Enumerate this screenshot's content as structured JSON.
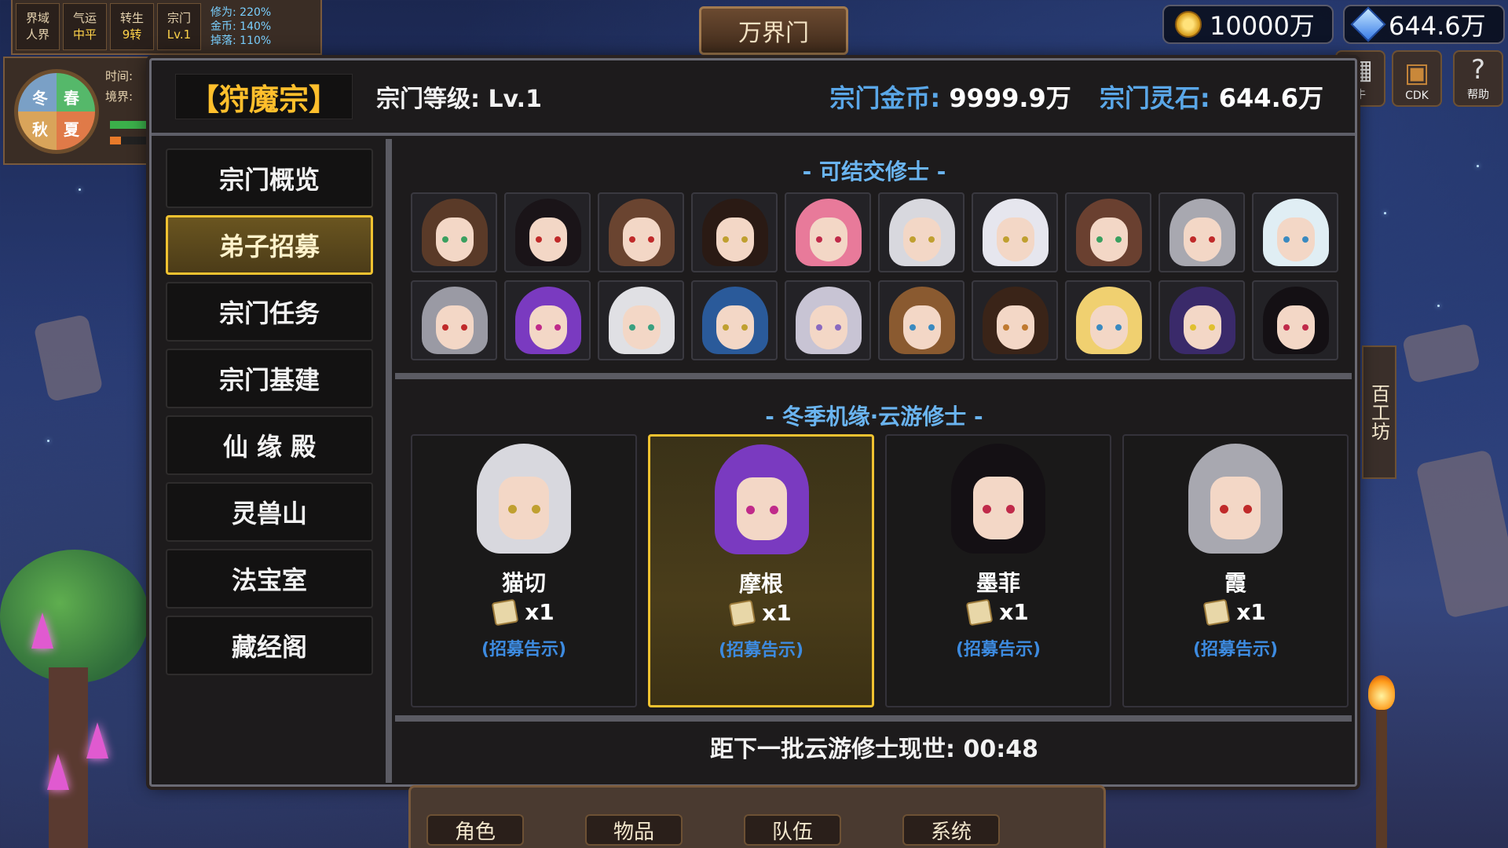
{
  "status_bar": {
    "cells": [
      {
        "top": "界域",
        "bottom": "人界"
      },
      {
        "top": "气运",
        "bottom": "中平"
      },
      {
        "top": "转生",
        "bottom": "9转"
      },
      {
        "top": "宗门",
        "bottom": "Lv.1"
      }
    ],
    "mods": [
      "修为: 220%",
      "金币: 140%",
      "掉落: 110%"
    ]
  },
  "season": {
    "time_label": "时间:",
    "realm_label": "境界:",
    "winter": "冬",
    "spring": "春",
    "autumn": "秋",
    "summer": "夏"
  },
  "title": "万界门",
  "currency": {
    "coins": "10000万",
    "gems": "644.6万"
  },
  "right_icons": [
    {
      "label": "牛"
    },
    {
      "label": "CDK"
    },
    {
      "label": "帮助"
    }
  ],
  "header": {
    "sect_name": "【狩魔宗】",
    "level_label": "宗门等级: Lv.1",
    "coin_label": "宗门金币:",
    "coin_value": "9999.9万",
    "stone_label": "宗门灵石:",
    "stone_value": "644.6万"
  },
  "sidebar": {
    "items": [
      {
        "label": "宗门概览",
        "active": false
      },
      {
        "label": "弟子招募",
        "active": true
      },
      {
        "label": "宗门任务",
        "active": false
      },
      {
        "label": "宗门基建",
        "active": false
      },
      {
        "label": "仙 缘 殿",
        "active": false
      },
      {
        "label": "灵兽山",
        "active": false
      },
      {
        "label": "法宝室",
        "active": false
      },
      {
        "label": "藏经阁",
        "active": false
      }
    ]
  },
  "befriendable": {
    "title": "- 可结交修士 -",
    "portraits": [
      {
        "hair": "#5a3a28",
        "eye": "#3aa060"
      },
      {
        "hair": "#1a1418",
        "eye": "#c02a2a"
      },
      {
        "hair": "#6a4430",
        "eye": "#c02a2a"
      },
      {
        "hair": "#2a1a14",
        "eye": "#c0a030"
      },
      {
        "hair": "#e87a9a",
        "eye": "#c02a4a"
      },
      {
        "hair": "#d8d8de",
        "eye": "#c0a030"
      },
      {
        "hair": "#e6e6ee",
        "eye": "#c0a030"
      },
      {
        "hair": "#6a4030",
        "eye": "#3aa060"
      },
      {
        "hair": "#a8a8b0",
        "eye": "#c02a2a"
      },
      {
        "hair": "#e0eef4",
        "eye": "#3a8ac0"
      },
      {
        "hair": "#9a9aa4",
        "eye": "#c02a2a"
      },
      {
        "hair": "#7a3ac0",
        "eye": "#c02a8a"
      },
      {
        "hair": "#e0e0e4",
        "eye": "#3aa080"
      },
      {
        "hair": "#2a5a9a",
        "eye": "#c0a030"
      },
      {
        "hair": "#c8c4d4",
        "eye": "#8a6ac0"
      },
      {
        "hair": "#8a5a30",
        "eye": "#3a8ac0"
      },
      {
        "hair": "#3a2418",
        "eye": "#c07a30"
      },
      {
        "hair": "#f0d070",
        "eye": "#3a8ac0"
      },
      {
        "hair": "#3a2a6a",
        "eye": "#e0c030"
      },
      {
        "hair": "#141014",
        "eye": "#c02a4a"
      }
    ]
  },
  "wanderers": {
    "title": "- 冬季机缘·云游修士 -",
    "cards": [
      {
        "name": "猫切",
        "qty": "x1",
        "notice": "(招募告示)",
        "selected": false,
        "hair": "#d8d8de",
        "eye": "#c0a030"
      },
      {
        "name": "摩根",
        "qty": "x1",
        "notice": "(招募告示)",
        "selected": true,
        "hair": "#7a3ac0",
        "eye": "#c02a8a"
      },
      {
        "name": "墨菲",
        "qty": "x1",
        "notice": "(招募告示)",
        "selected": false,
        "hair": "#141014",
        "eye": "#c02a4a"
      },
      {
        "name": "霞",
        "qty": "x1",
        "notice": "(招募告示)",
        "selected": false,
        "hair": "#a8a8b0",
        "eye": "#c02a2a"
      }
    ]
  },
  "countdown": "距下一批云游修士现世: 00:48",
  "bottom_nav": [
    {
      "label": "角色"
    },
    {
      "label": "物品"
    },
    {
      "label": "队伍"
    },
    {
      "label": "系统"
    }
  ],
  "banner_text": "百工坊"
}
